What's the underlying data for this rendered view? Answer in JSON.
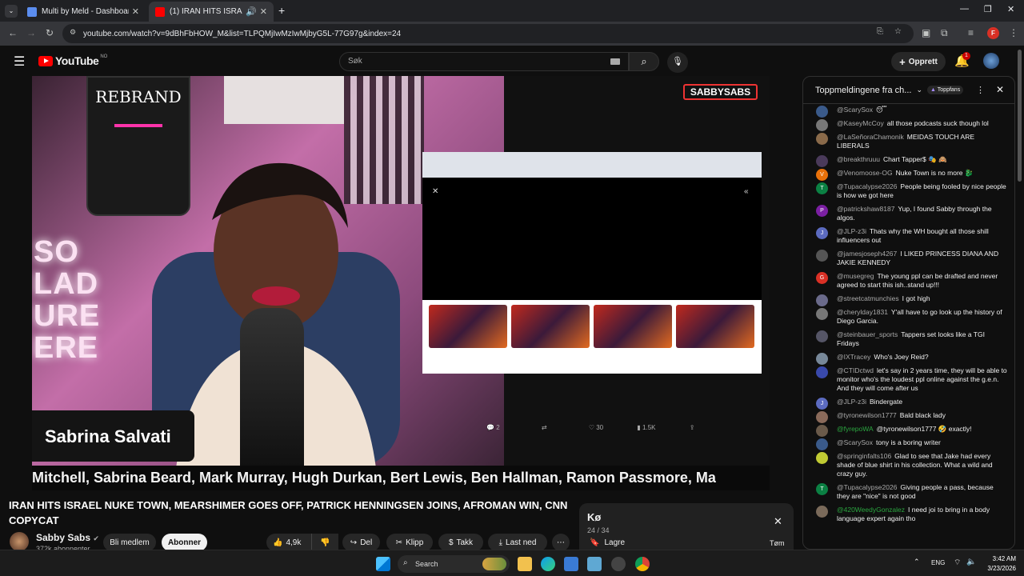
{
  "browser": {
    "tabs": [
      {
        "title": "Multi by Meld - Dashboard.",
        "active": false
      },
      {
        "title": "(1) IRAN HITS ISRAEL NUKE",
        "active": true
      }
    ],
    "url": "youtube.com/watch?v=9dBhFbHOW_M&list=TLPQMjIwMzIwMjbyG5L-77G97g&index=24",
    "profile_initial": "F"
  },
  "header": {
    "logo_text": "YouTube",
    "region": "NO",
    "search_placeholder": "Søk",
    "create_label": "Opprett",
    "notification_count": "1"
  },
  "video": {
    "watermark": "SABBYSABS",
    "chalkboard_text": "REBRAND",
    "neon_text": [
      "SO",
      "LAD",
      "URE",
      "ERE"
    ],
    "name_card": "Sabrina Salvati",
    "ticker": "Mitchell, Sabrina Beard, Mark Murray, Hugh Durkan, Bert Lewis, Ben Hallman, Ramon Passmore, Ma",
    "embed_actions": {
      "replies": "2",
      "likes": "30",
      "views": "1.5K"
    }
  },
  "meta": {
    "title": "IRAN HITS ISRAEL NUKE TOWN, MEARSHIMER GOES OFF, PATRICK HENNINGSEN JOINS, AFROMAN WIN, CNN COPYCAT",
    "channel": "Sabby Sabs",
    "subscribers": "372k abonnenter",
    "join_label": "Bli medlem",
    "subscribe_label": "Abonner",
    "like_count": "4,9k",
    "share_label": "Del",
    "clip_label": "Klipp",
    "thanks_label": "Takk",
    "download_label": "Last ned"
  },
  "queue": {
    "title": "Kø",
    "position": "24 / 34",
    "save_label": "Lagre",
    "clear_label": "Tøm"
  },
  "chat": {
    "title": "Toppmeldingene fra ch...",
    "badge": "Toppfans",
    "messages": [
      {
        "author": "@ScarySox",
        "text": "😴",
        "initial": "",
        "color": "#3a5a8a"
      },
      {
        "author": "@KaseyMcCoy",
        "text": "all those podcasts suck though lol",
        "initial": "",
        "color": "#777"
      },
      {
        "author": "@LaSeñoraChamonik",
        "text": "MEIDAS TOUCH ARE LIBERALS",
        "initial": "",
        "color": "#8a6a4a"
      },
      {
        "author": "@breakthruuu",
        "text": "Chart Tapper$ 🎭 🙈",
        "initial": "",
        "color": "#4a3a5a"
      },
      {
        "author": "@Venomoose-OG",
        "text": "Nuke Town is no more 🐉",
        "initial": "V",
        "color": "#e8710a"
      },
      {
        "author": "@Tupacalypse2026",
        "text": "People being fooled by nice people is how we got here",
        "initial": "T",
        "color": "#0b8043"
      },
      {
        "author": "@patrickshaw8187",
        "text": "Yup, I found Sabby through the algos.",
        "initial": "P",
        "color": "#7b1fa2"
      },
      {
        "author": "@JLP-z3i",
        "text": "Thats why the WH bought all those shill influencers out",
        "initial": "J",
        "color": "#5c6bc0"
      },
      {
        "author": "@jamesjoseph4267",
        "text": "I LIKED PRINCESS DIANA AND JAKIE KENNEDY",
        "initial": "",
        "color": "#555"
      },
      {
        "author": "@musegreg",
        "text": "The young ppl can be drafted and never agreed to start this ish..stand up!!!",
        "initial": "G",
        "color": "#d93025"
      },
      {
        "author": "@streetcatmunchies",
        "text": "I got high",
        "initial": "",
        "color": "#6a6a8a"
      },
      {
        "author": "@cherylday1831",
        "text": "Y'all have to go look up the history of Diego Garcia.",
        "initial": "",
        "color": "#777"
      },
      {
        "author": "@steinbauer_sports",
        "text": "Tappers set looks like a TGI Fridays",
        "initial": "",
        "color": "#556"
      },
      {
        "author": "@IXTracey",
        "text": "Who's Joey Reid?",
        "initial": "",
        "color": "#789"
      },
      {
        "author": "@CTIDctwd",
        "text": "let's say in 2 years time, they will be able to monitor who's the loudest ppl online against the g.e.n. And they will come after us",
        "initial": "",
        "color": "#3949ab"
      },
      {
        "author": "@JLP-z3i",
        "text": "Bindergate",
        "initial": "J",
        "color": "#5c6bc0"
      },
      {
        "author": "@tyronewilson1777",
        "text": "Bald black lady",
        "initial": "",
        "color": "#8a6a5a"
      },
      {
        "author": "@fyrepoWA",
        "text": "@tyronewilson1777 🤣 exactly!",
        "initial": "",
        "color": "#6a5a4a",
        "green": true
      },
      {
        "author": "@ScarySox",
        "text": "tony is a boring writer",
        "initial": "",
        "color": "#3a5a8a"
      },
      {
        "author": "@springinfalts106",
        "text": "Glad to see that Jake had every shade of blue shirt in his collection. What a wild and crazy guy.",
        "initial": "",
        "color": "#c0ca33"
      },
      {
        "author": "@Tupacalypse2026",
        "text": "Giving people a pass, because they are \"nice\" is not good",
        "initial": "T",
        "color": "#0b8043"
      },
      {
        "author": "@420WeedyGonzalez",
        "text": "I need joi to bring in a body language expert again tho",
        "initial": "",
        "color": "#7a6a5a",
        "green": true
      }
    ]
  },
  "taskbar": {
    "search_label": "Search",
    "language": "ENG",
    "time": "3:42 AM",
    "date": "3/23/2026"
  }
}
